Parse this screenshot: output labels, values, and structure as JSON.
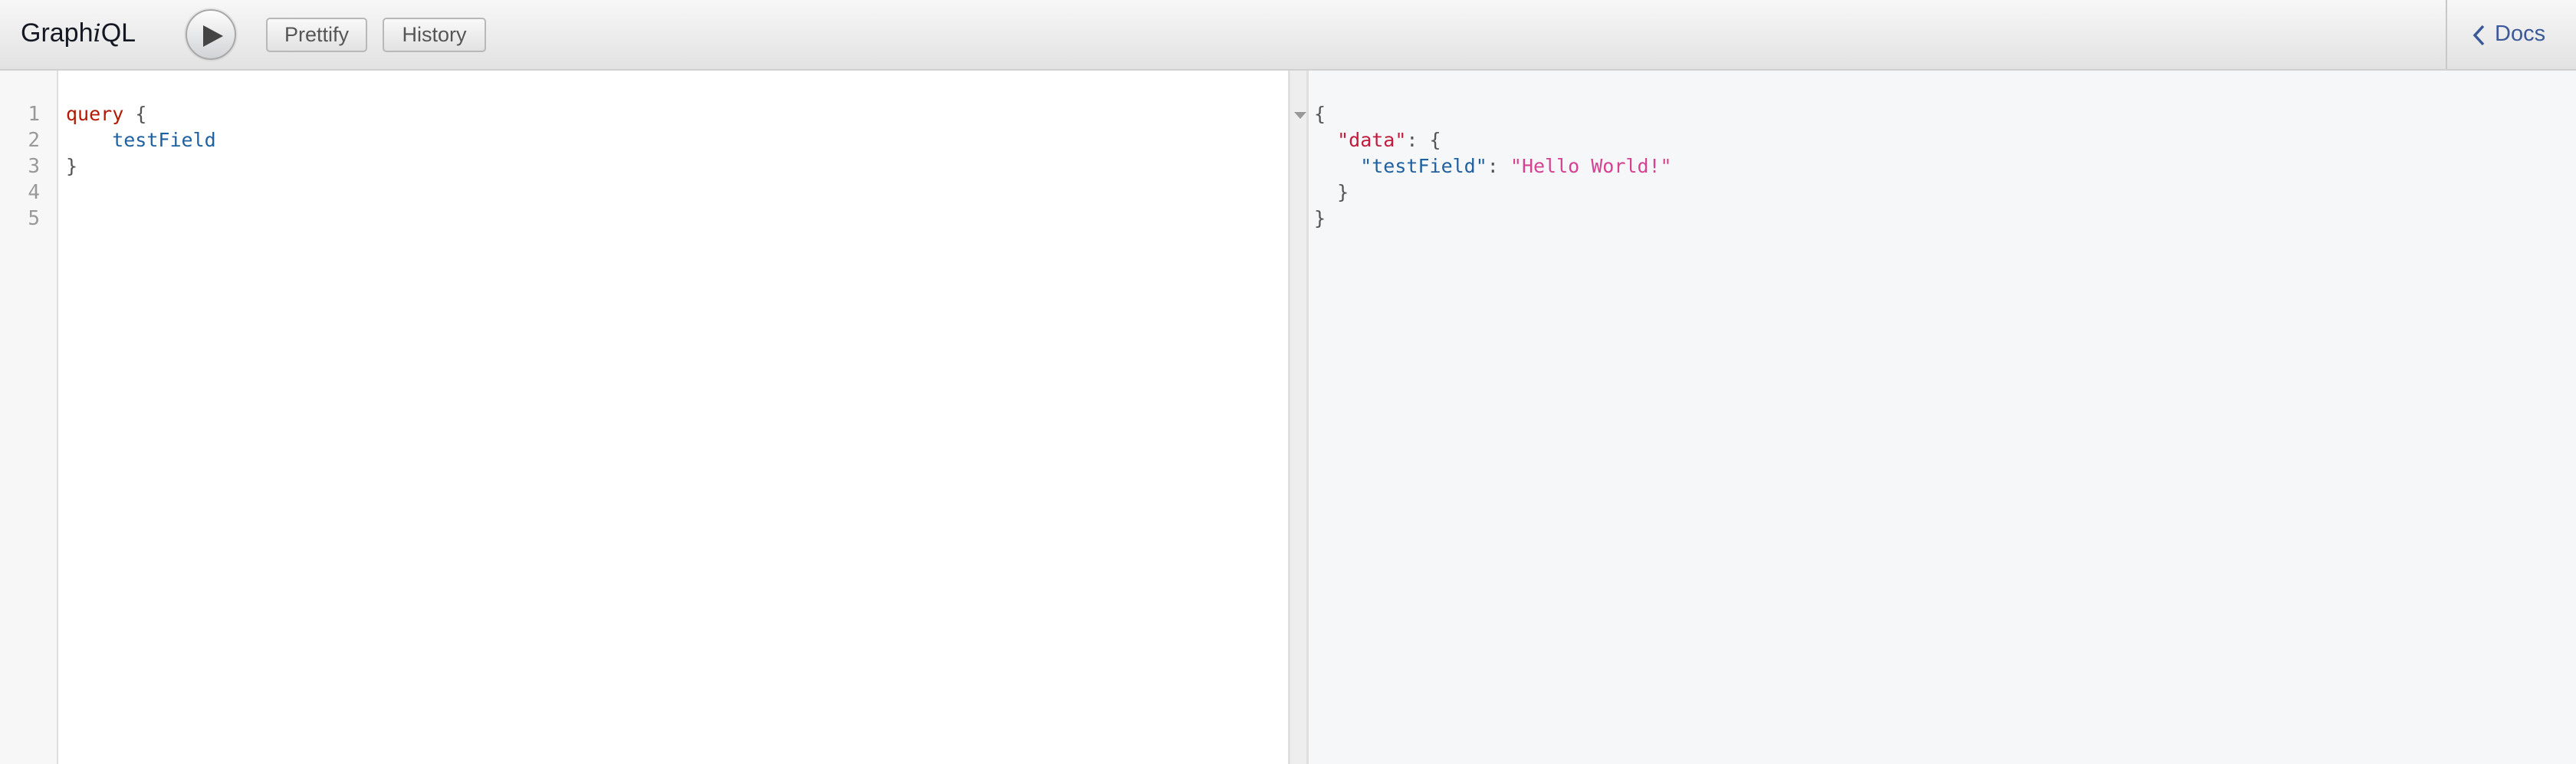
{
  "header": {
    "title_prefix": "Graph",
    "title_italic": "i",
    "title_suffix": "QL",
    "execute_icon": "play-icon",
    "prettify_label": "Prettify",
    "history_label": "History",
    "docs_label": "Docs",
    "docs_icon": "chevron-left-icon"
  },
  "editor": {
    "line_numbers": [
      "1",
      "2",
      "3",
      "4",
      "5"
    ],
    "lines": {
      "l1_keyword": "query",
      "l1_brace": " {",
      "l2_field": "    testField",
      "l3_brace": "}"
    }
  },
  "result": {
    "fold_icon": "fold-triangle-icon",
    "lines": {
      "r1": "{",
      "r2_key": "  \"data\"",
      "r2_rest": ": {",
      "r3_key": "    \"testField\"",
      "r3_colon": ": ",
      "r3_value": "\"Hello World!\"",
      "r4": "  }",
      "r5": "}"
    }
  },
  "colors": {
    "keyword": "#b11a04",
    "field": "#1f61a0",
    "json_key_data": "#c41a3c",
    "json_string": "#d64292",
    "docs_link": "#3b5998",
    "result_bg": "#f6f7f8"
  }
}
